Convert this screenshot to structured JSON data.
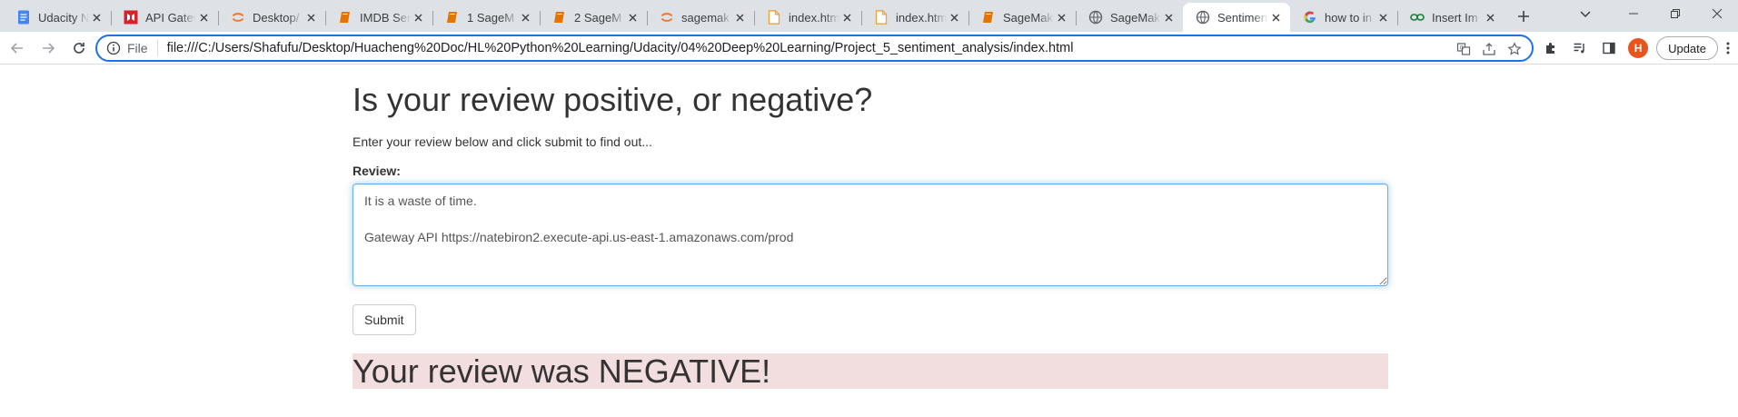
{
  "browser": {
    "tabs": [
      {
        "title": "Udacity N",
        "icon": "google-docs-icon",
        "color": "#4285f4"
      },
      {
        "title": "API Gatew",
        "icon": "api-gateway-icon",
        "color": "#d5232c"
      },
      {
        "title": "Desktop/",
        "icon": "jupyter-icon",
        "color": "#f37726"
      },
      {
        "title": "IMDB Sen",
        "icon": "book-icon",
        "color": "#e37400"
      },
      {
        "title": "1 SageM",
        "icon": "book-icon",
        "color": "#e37400"
      },
      {
        "title": "2 SageM",
        "icon": "book-icon",
        "color": "#e37400"
      },
      {
        "title": "sagemak",
        "icon": "jupyter-icon",
        "color": "#f37726"
      },
      {
        "title": "index.htm",
        "icon": "file-icon",
        "color": "#e8a33d"
      },
      {
        "title": "index.htm",
        "icon": "file-icon",
        "color": "#e8a33d"
      },
      {
        "title": "SageMak",
        "icon": "book-icon",
        "color": "#e37400"
      },
      {
        "title": "SageMak",
        "icon": "globe-icon",
        "color": "#5f6368"
      },
      {
        "title": "Sentimen",
        "icon": "globe-icon",
        "color": "#5f6368",
        "active": true
      },
      {
        "title": "how to in",
        "icon": "google-icon",
        "color": "#4285f4"
      },
      {
        "title": "Insert Im",
        "icon": "link-icon",
        "color": "#188038"
      }
    ],
    "address": {
      "scheme_label": "File",
      "url": "file:///C:/Users/Shafufu/Desktop/Huacheng%20Doc/HL%20Python%20Learning/Udacity/04%20Deep%20Learning/Project_5_sentiment_analysis/index.html"
    },
    "profile_initial": "H",
    "update_label": "Update",
    "accent": "#1a73e8"
  },
  "page": {
    "heading": "Is your review positive, or negative?",
    "description": "Enter your review below and click submit to find out...",
    "review_label": "Review:",
    "review_text": "It is a waste of time.\n\nGateway API https://natebiron2.execute-api.us-east-1.amazonaws.com/prod",
    "submit_label": "Submit",
    "result_text": "Your review was NEGATIVE!",
    "result_bg": "#f2dede"
  }
}
